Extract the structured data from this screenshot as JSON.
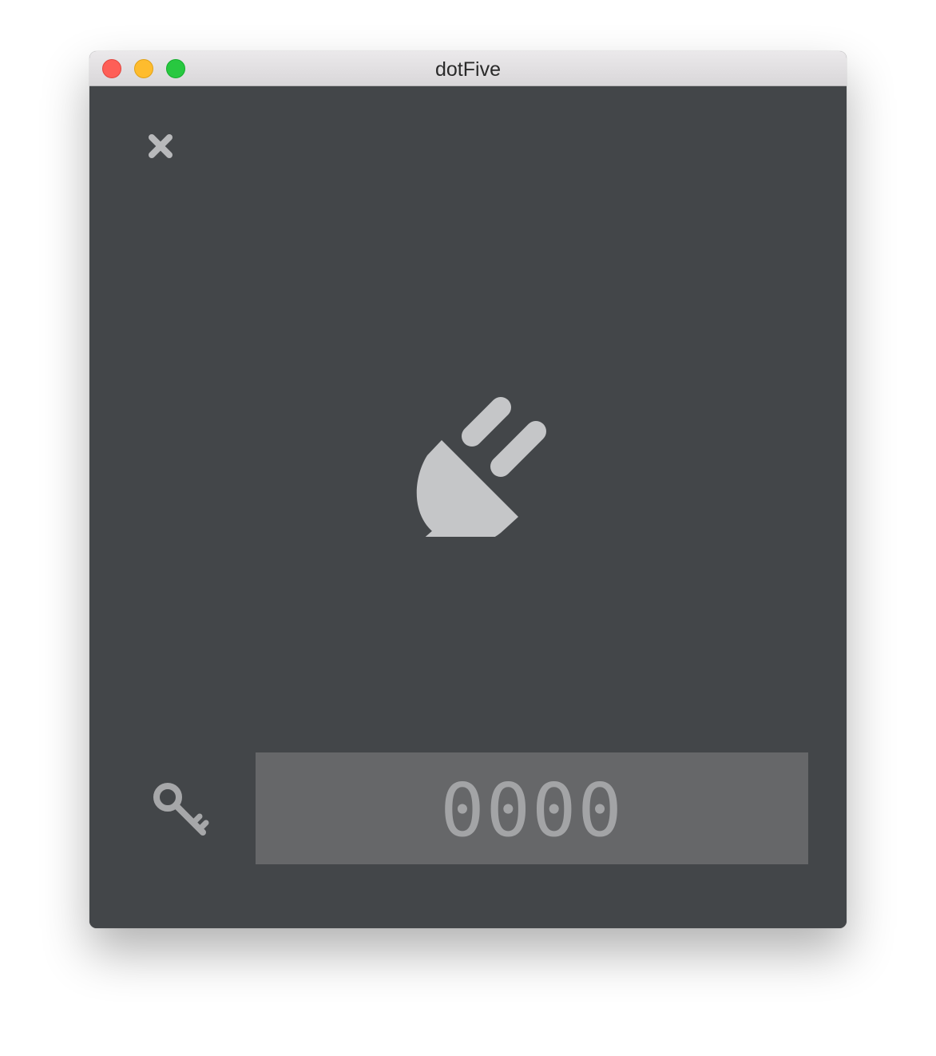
{
  "window": {
    "title": "dotFive",
    "controls": [
      "close",
      "minimize",
      "zoom"
    ]
  },
  "icons": {
    "close": "close-icon",
    "status": "plug-icon",
    "key": "key-icon"
  },
  "pin": {
    "value": "0000"
  },
  "colors": {
    "background": "#434649",
    "icon": "#c5c6c8",
    "field": "#666769",
    "field_text": "#a3a4a6"
  }
}
